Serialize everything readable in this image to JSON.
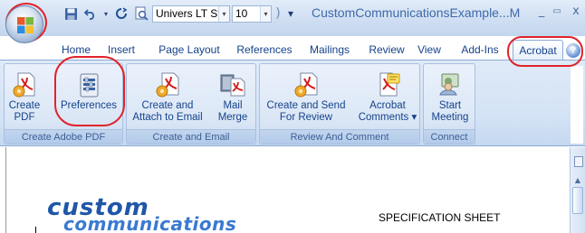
{
  "window": {
    "title": "CustomCommunicationsExample...M",
    "minimize_glyph": "_",
    "restore_glyph": "▭",
    "close_glyph": "x"
  },
  "quick_access": {
    "font_name": "Univers LT Stc",
    "font_size": "10",
    "customize_glyph": "▾"
  },
  "tabs": [
    "Home",
    "Insert",
    "Page Layout",
    "References",
    "Mailings",
    "Review",
    "View",
    "Add-Ins",
    "Acrobat"
  ],
  "active_tab": "Acrobat",
  "help_glyph": "?",
  "ribbon": {
    "groups": [
      {
        "label": "Create Adobe PDF",
        "buttons": [
          {
            "line1": "Create",
            "line2": "PDF"
          },
          {
            "line1": "Preferences",
            "line2": ""
          }
        ]
      },
      {
        "label": "Create and Email",
        "buttons": [
          {
            "line1": "Create and",
            "line2": "Attach to Email"
          },
          {
            "line1": "Mail",
            "line2": "Merge"
          }
        ]
      },
      {
        "label": "Review And Comment",
        "buttons": [
          {
            "line1": "Create and Send",
            "line2": "For Review"
          },
          {
            "line1": "Acrobat",
            "line2": "Comments ▾"
          }
        ]
      },
      {
        "label": "Connect",
        "buttons": [
          {
            "line1": "Start",
            "line2": "Meeting"
          }
        ]
      }
    ]
  },
  "document": {
    "logo_line1": "custom",
    "logo_line2": "communications",
    "heading": "SPECIFICATION SHEET"
  },
  "colors": {
    "highlight_ring": "#e0232a",
    "ribbon_text": "#15428b",
    "logo_blue": "#1f56a8"
  }
}
